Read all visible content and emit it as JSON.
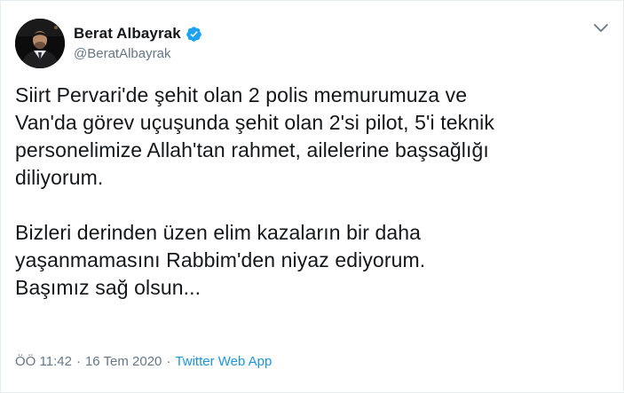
{
  "user": {
    "display_name": "Berat Albayrak",
    "handle": "@BeratAlbayrak",
    "verified": true,
    "avatar_icon": "profile-photo-avatar"
  },
  "tweet": {
    "paragraph_1": "Siirt Pervari'de şehit olan 2 polis memurumuza ve\nVan'da görev uçuşunda şehit olan 2'si pilot, 5'i teknik\npersonelimize Allah'tan rahmet, ailelerine başsağlığı\ndiliyorum.",
    "paragraph_2": "Bizleri derinden üzen elim kazaların bir daha\nyaşanmamasını Rabbim'den niyaz ediyorum.\nBaşımız sağ olsun..."
  },
  "meta": {
    "time": "ÖÖ 11:42",
    "separator": "·",
    "date": "16 Tem 2020",
    "source": "Twitter Web App"
  },
  "colors": {
    "verified_badge": "#1da1f2",
    "link": "#1b95e0",
    "secondary_text": "#657786",
    "primary_text": "#14171a",
    "border": "#e6ecf0"
  },
  "icons": {
    "verified": "verified-badge-icon",
    "more": "chevron-down-icon"
  }
}
